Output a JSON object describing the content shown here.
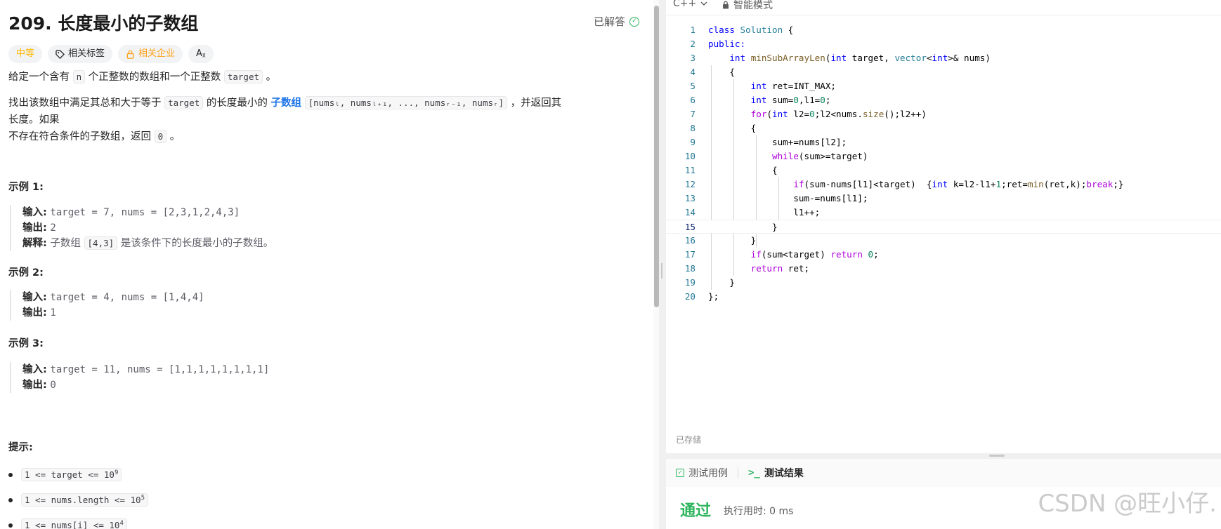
{
  "problem": {
    "title": "209. 长度最小的子数组",
    "solved_label": "已解答",
    "tags": {
      "difficulty": "中等",
      "related_tags": "相关标签",
      "related_companies": "相关企业",
      "translate": "Aᵪ"
    },
    "desc1": {
      "p1": "给定一个含有 ",
      "code_n": "n",
      "p2": " 个正整数的数组和一个正整数 ",
      "code_target": "target",
      "p3": " 。"
    },
    "desc2": {
      "p1": "找出该数组中满足其总和大于等于 ",
      "code_target": "target",
      "p2": " 的长度最小的 ",
      "link": "子数组",
      "p3": " ",
      "code_range": "[numsₗ, numsₗ₊₁, ..., numsᵣ₋₁, numsᵣ]",
      "p4": " ，并返回其长度。如果",
      "p5": "不存在符合条件的子数组，返回 ",
      "code_zero": "0",
      "p6": " 。"
    },
    "examples": [
      {
        "title": "示例 1:",
        "input_label": "输入:",
        "input": "target = 7, nums = [2,3,1,2,4,3]",
        "output_label": "输出:",
        "output": "2",
        "explain_label": "解释:",
        "explain_p1": "子数组 ",
        "explain_code": "[4,3]",
        "explain_p2": " 是该条件下的长度最小的子数组。"
      },
      {
        "title": "示例 2:",
        "input_label": "输入:",
        "input": "target = 4, nums = [1,4,4]",
        "output_label": "输出:",
        "output": "1"
      },
      {
        "title": "示例 3:",
        "input_label": "输入:",
        "input": "target = 11, nums = [1,1,1,1,1,1,1,1]",
        "output_label": "输出:",
        "output": "0"
      }
    ],
    "hints_title": "提示:",
    "hints": [
      {
        "base": "1 <= target <= 10",
        "sup": "9"
      },
      {
        "base": "1 <= nums.length <= 10",
        "sup": "5"
      },
      {
        "base": "1 <= nums[i] <= 10",
        "sup": "4"
      }
    ]
  },
  "editor": {
    "language": "C++",
    "mode": "智能模式",
    "saved_label": "已存储",
    "line_numbers": [
      "1",
      "2",
      "3",
      "4",
      "5",
      "6",
      "7",
      "8",
      "9",
      "10",
      "11",
      "12",
      "13",
      "14",
      "15",
      "16",
      "17",
      "18",
      "19",
      "20"
    ],
    "code": {
      "l1_a": "class",
      "l1_b": "Solution",
      "l1_c": " {",
      "l2": "public:",
      "l3_a": "int",
      "l3_b": "minSubArrayLen",
      "l3_c": "(",
      "l3_d": "int",
      "l3_e": " target, ",
      "l3_f": "vector",
      "l3_g": "<",
      "l3_h": "int",
      "l3_i": ">& nums)",
      "l4": "{",
      "l5_a": "int",
      "l5_b": " ret=INT_MAX;",
      "l6_a": "int",
      "l6_b": " sum=",
      "l6_c": "0",
      "l6_d": ",l1=",
      "l6_e": "0",
      "l6_f": ";",
      "l7_a": "for",
      "l7_b": "(",
      "l7_c": "int",
      "l7_d": " l2=",
      "l7_e": "0",
      "l7_f": ";l2<nums.",
      "l7_g": "size",
      "l7_h": "();l2++)",
      "l8": "{",
      "l9": "sum+=nums[l2];",
      "l10_a": "while",
      "l10_b": "(sum>=target)",
      "l11": "{",
      "l12_a": "if",
      "l12_b": "(sum-nums[l1]<target)  {",
      "l12_c": "int",
      "l12_d": " k=l2-l1+",
      "l12_e": "1",
      "l12_f": ";ret=",
      "l12_g": "min",
      "l12_h": "(ret,k);",
      "l12_i": "break",
      "l12_j": ";}",
      "l13": "sum-=nums[l1];",
      "l14": "l1++;",
      "l15": "}",
      "l16": "}",
      "l17_a": "if",
      "l17_b": "(sum<target) ",
      "l17_c": "return",
      "l17_d": " ",
      "l17_e": "0",
      "l17_f": ";",
      "l18_a": "return",
      "l18_b": " ret;",
      "l19": "}",
      "l20": "};"
    }
  },
  "results": {
    "tab_testcase": "测试用例",
    "tab_result": "测试结果",
    "status": "通过",
    "runtime": "执行用时: 0 ms"
  },
  "watermark": "CSDN @旺小仔."
}
